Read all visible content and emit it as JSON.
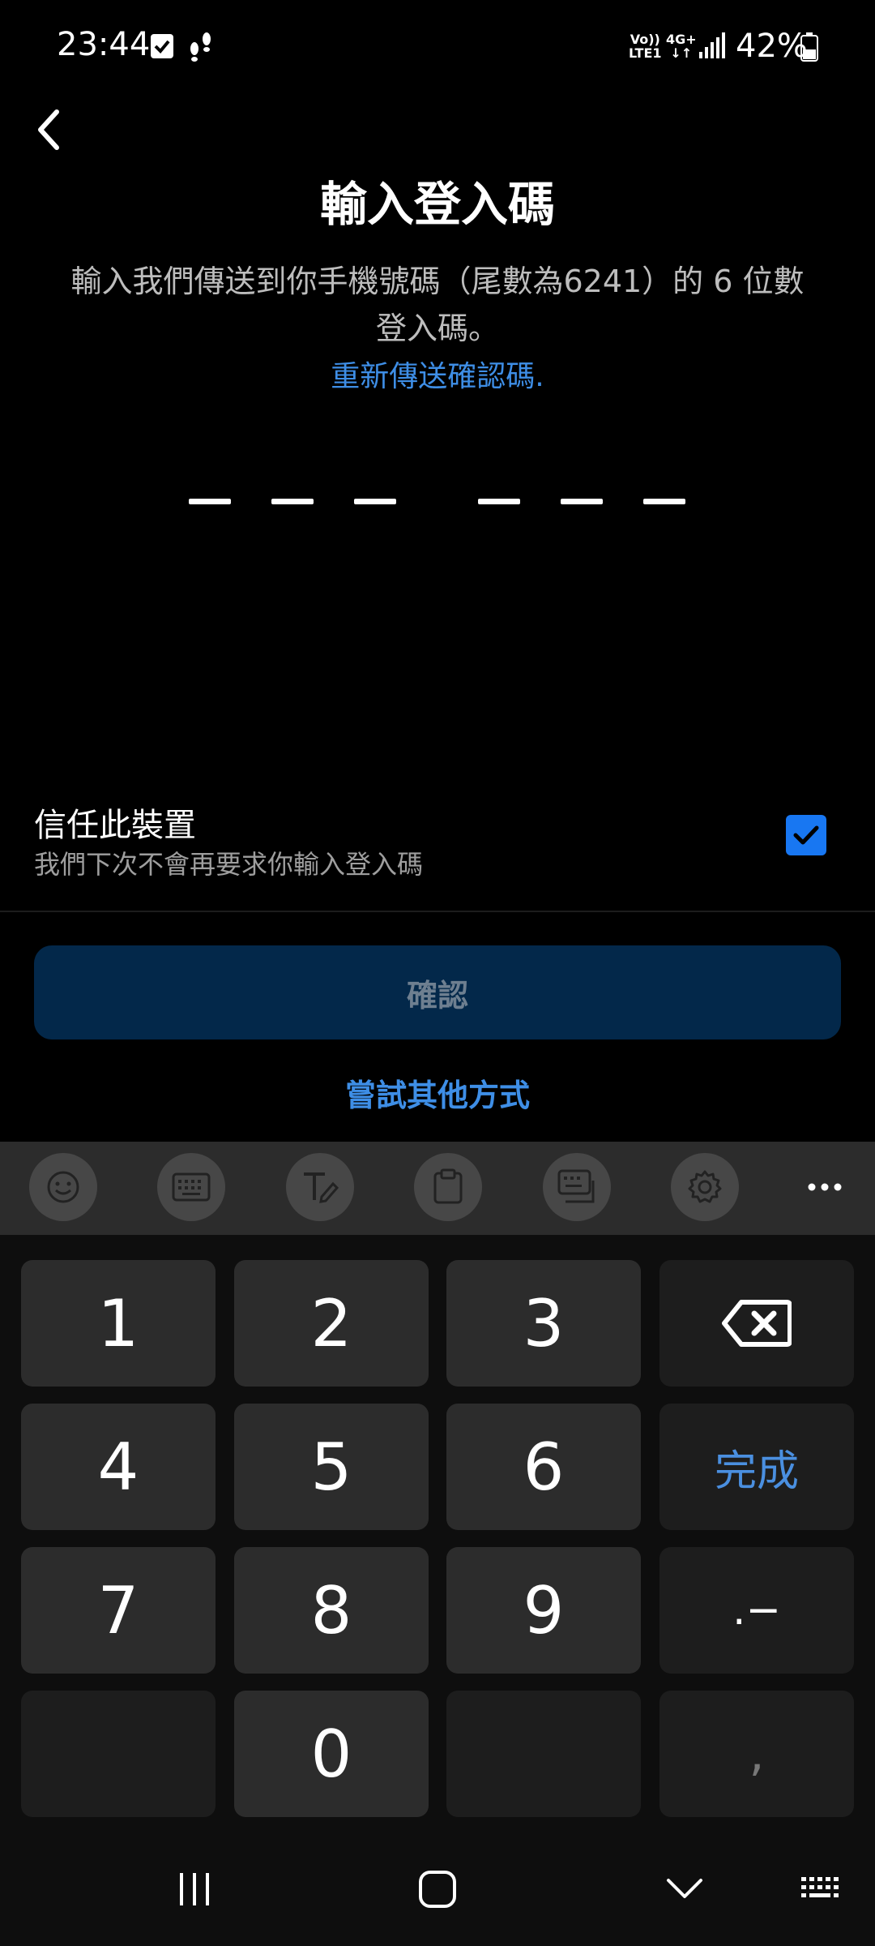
{
  "status_bar": {
    "time": "23:44",
    "volte_top": "Vo))",
    "volte_bottom": "LTE1",
    "network_top": "4G+",
    "network_bottom": "↓↑",
    "battery_percent": "42%",
    "battery_level": 0.42
  },
  "header": {
    "title": "輸入登入碼",
    "description": "輸入我們傳送到你手機號碼（尾數為6241）的 6 位數登入碼。",
    "resend_link": "重新傳送確認碼."
  },
  "code_input": {
    "length": 6,
    "value": ""
  },
  "trust_device": {
    "title": "信任此裝置",
    "subtitle": "我們下次不會再要求你輸入登入碼",
    "checked": true
  },
  "actions": {
    "confirm_label": "確認",
    "other_method_label": "嘗試其他方式"
  },
  "keyboard": {
    "toolbar": [
      "emoji-icon",
      "keyboard-icon",
      "handwriting-icon",
      "clipboard-icon",
      "keyboard-mode-icon",
      "gear-icon",
      "more-icon"
    ],
    "keys": {
      "k1": "1",
      "k2": "2",
      "k3": "3",
      "k4": "4",
      "k5": "5",
      "k6": "6",
      "k7": "7",
      "k8": "8",
      "k9": "9",
      "k0": "0",
      "done": "完成",
      "symbols": ".−",
      "comma": ","
    }
  },
  "colors": {
    "accent": "#3e8ee6",
    "checkbox": "#1877f2",
    "confirm_bg": "#03284a"
  }
}
